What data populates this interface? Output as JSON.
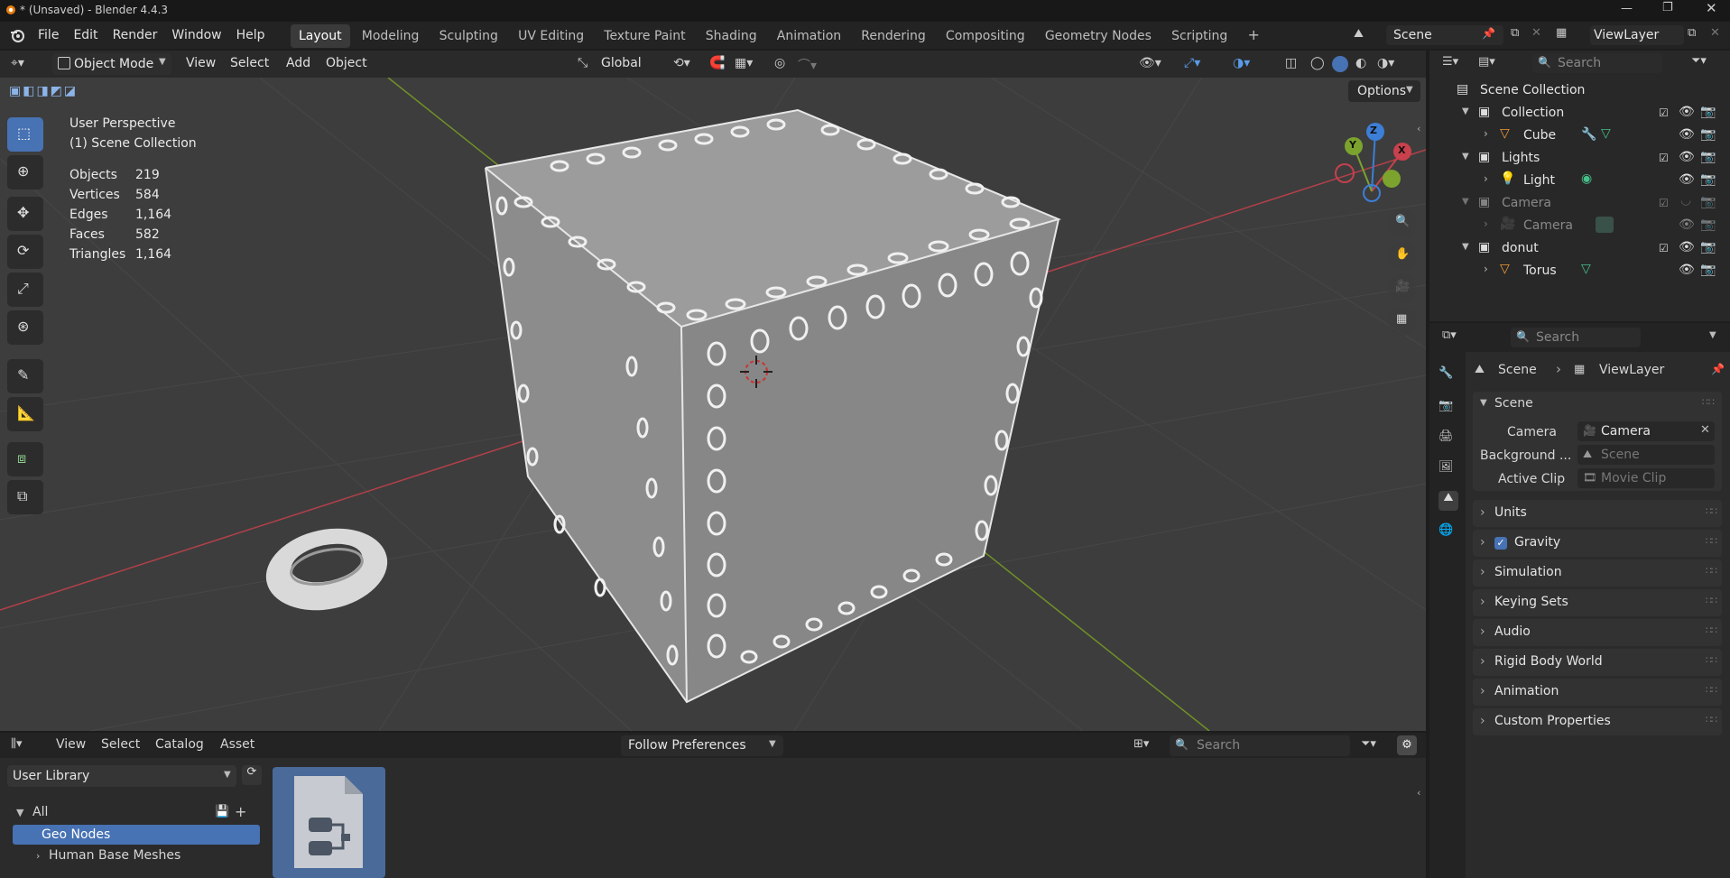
{
  "window": {
    "title": "* (Unsaved) - Blender 4.4.3"
  },
  "menubar": {
    "items": [
      "File",
      "Edit",
      "Render",
      "Window",
      "Help"
    ],
    "workspaces": [
      "Layout",
      "Modeling",
      "Sculpting",
      "UV Editing",
      "Texture Paint",
      "Shading",
      "Animation",
      "Rendering",
      "Compositing",
      "Geometry Nodes",
      "Scripting"
    ],
    "scene": "Scene",
    "view_layer": "ViewLayer"
  },
  "viewport": {
    "mode": "Object Mode",
    "menus": [
      "View",
      "Select",
      "Add",
      "Object"
    ],
    "transform": "Global",
    "options": "Options",
    "perspective": "User Perspective",
    "collection": "(1) Scene Collection",
    "stats": [
      {
        "label": "Objects",
        "value": "219"
      },
      {
        "label": "Vertices",
        "value": "584"
      },
      {
        "label": "Edges",
        "value": "1,164"
      },
      {
        "label": "Faces",
        "value": "582"
      },
      {
        "label": "Triangles",
        "value": "1,164"
      }
    ],
    "gizmo": {
      "x": "X",
      "y": "Y",
      "z": "Z"
    }
  },
  "asset_browser": {
    "menus": [
      "View",
      "Select",
      "Catalog",
      "Asset"
    ],
    "import_method": "Follow Preferences",
    "search_placeholder": "Search",
    "library": "User Library",
    "tree": {
      "all": "All",
      "selected": "Geo Nodes",
      "next": "Human Base Meshes"
    }
  },
  "outliner": {
    "search_placeholder": "Search",
    "root": "Scene Collection",
    "rows": [
      {
        "name": "Collection",
        "level": 1
      },
      {
        "name": "Cube",
        "level": 2
      },
      {
        "name": "Lights",
        "level": 1
      },
      {
        "name": "Light",
        "level": 2
      },
      {
        "name": "Camera",
        "level": 1
      },
      {
        "name": "Camera",
        "level": 2
      },
      {
        "name": "donut",
        "level": 1
      },
      {
        "name": "Torus",
        "level": 2
      }
    ]
  },
  "properties": {
    "search_placeholder": "Search",
    "breadcrumb": {
      "scene": "Scene",
      "view_layer": "ViewLayer"
    },
    "scene_section": "Scene",
    "fields": [
      {
        "label": "Camera",
        "value": "Camera"
      },
      {
        "label": "Background ...",
        "value": "Scene"
      },
      {
        "label": "Active Clip",
        "value": "Movie Clip"
      }
    ],
    "sections": [
      "Units",
      "Gravity",
      "Simulation",
      "Keying Sets",
      "Audio",
      "Rigid Body World",
      "Animation",
      "Custom Properties"
    ]
  },
  "colors": {
    "accent": "#4772b3",
    "x_axis": "#c8414c",
    "y_axis": "#7ba32e",
    "z_axis": "#3d7ed6"
  }
}
